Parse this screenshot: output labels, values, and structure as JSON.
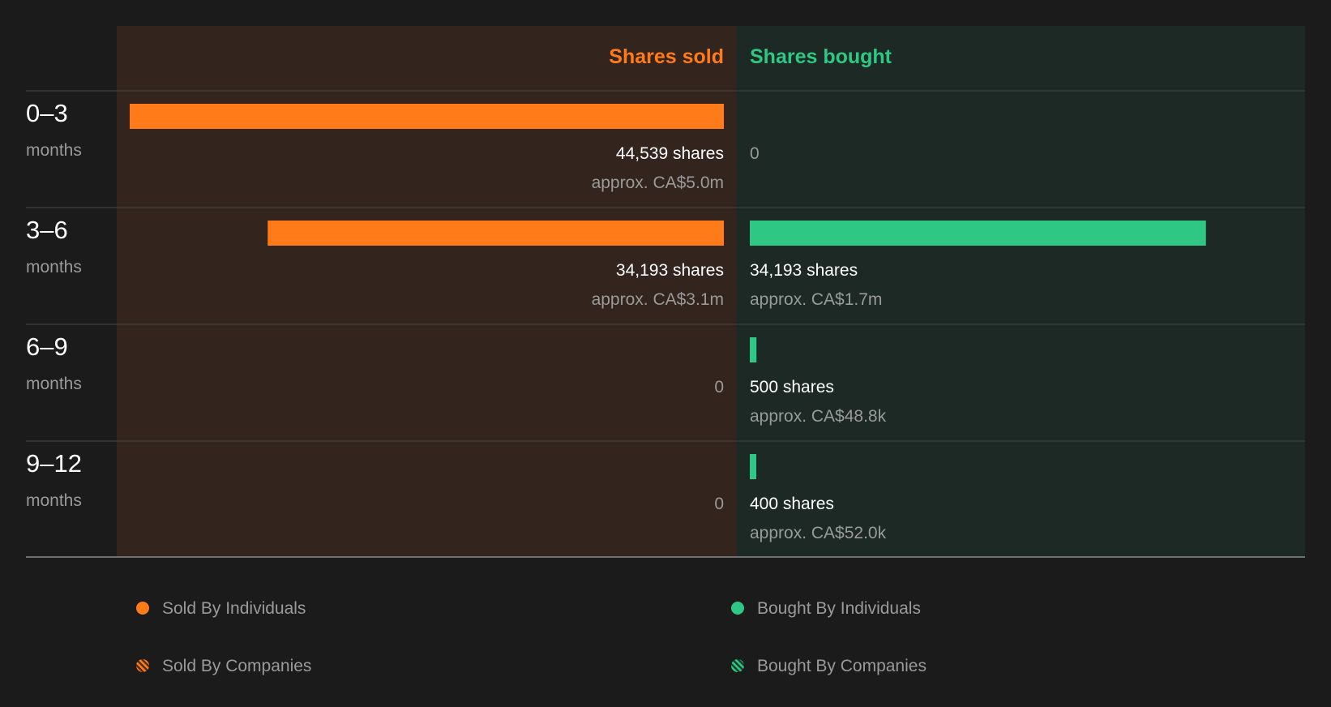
{
  "chart_data": {
    "type": "bar",
    "orientation": "horizontal-diverging",
    "columns": {
      "sold": "Shares sold",
      "bought": "Shares bought"
    },
    "period_unit": "months",
    "periods": [
      "0–3",
      "3–6",
      "6–9",
      "9–12"
    ],
    "series": [
      {
        "name": "Shares sold",
        "color": "#ff7b1a",
        "values": [
          44539,
          34193,
          0,
          0
        ],
        "shares_labels": [
          "44,539 shares",
          "34,193 shares",
          "0",
          "0"
        ],
        "value_labels": [
          "approx. CA$5.0m",
          "approx. CA$3.1m",
          "",
          ""
        ]
      },
      {
        "name": "Shares bought",
        "color": "#2ec783",
        "values": [
          0,
          34193,
          500,
          400
        ],
        "shares_labels": [
          "0",
          "34,193 shares",
          "500 shares",
          "400 shares"
        ],
        "value_labels": [
          "",
          "approx. CA$1.7m",
          "approx. CA$48.8k",
          "approx. CA$52.0k"
        ]
      }
    ],
    "xlim": [
      0,
      44539
    ]
  },
  "legend": [
    {
      "label": "Sold By Individuals",
      "style": "solid",
      "color": "#ff7b1a"
    },
    {
      "label": "Bought By Individuals",
      "style": "solid",
      "color": "#2ec783"
    },
    {
      "label": "Sold By Companies",
      "style": "striped",
      "color": "#ff7b1a"
    },
    {
      "label": "Bought By Companies",
      "style": "striped",
      "color": "#2ec783"
    }
  ],
  "colors": {
    "background": "#1b1b1b",
    "sold_accent": "#ff7b1a",
    "bought_accent": "#2ec783"
  }
}
